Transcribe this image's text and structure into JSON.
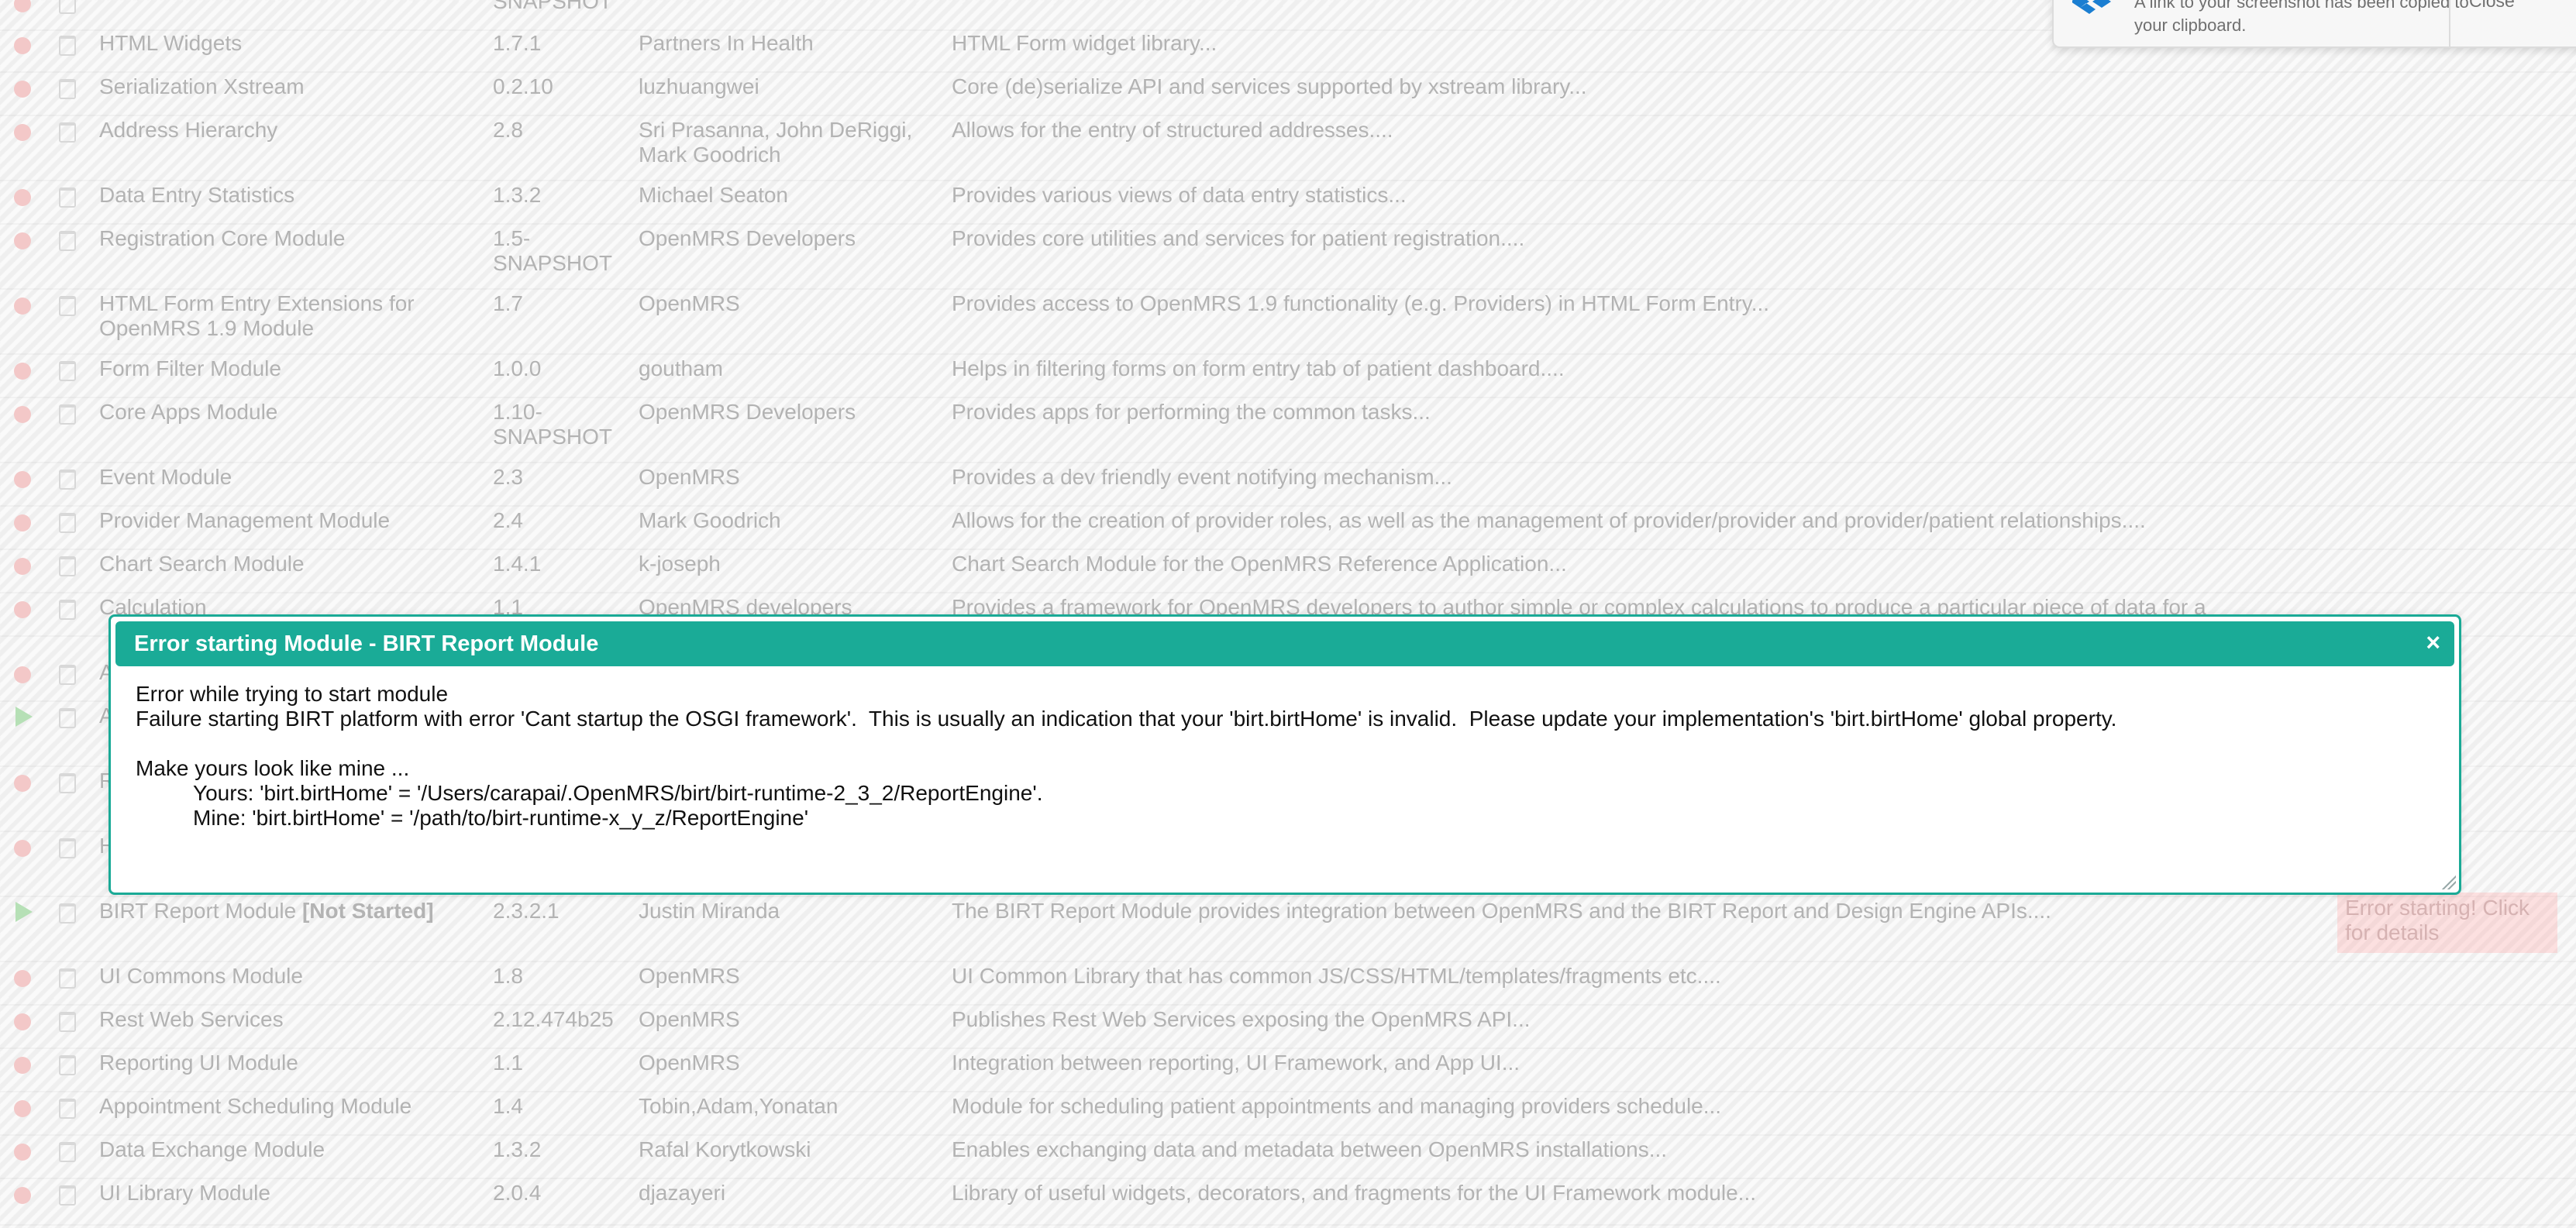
{
  "rows": [
    {
      "name": "",
      "name_suffix": "",
      "version": "SNAPSHOT",
      "author": "",
      "description": "",
      "status": "",
      "icon": "stop-icon"
    },
    {
      "name": "HTML Widgets",
      "name_suffix": "",
      "version": "1.7.1",
      "author": "Partners In Health",
      "description": "HTML Form widget library...",
      "status": "",
      "icon": "stop-icon"
    },
    {
      "name": "Serialization Xstream",
      "name_suffix": "",
      "version": "0.2.10",
      "author": "luzhuangwei",
      "description": "Core (de)serialize API and services supported by xstream library...",
      "status": "",
      "icon": "stop-icon"
    },
    {
      "name": "Address Hierarchy",
      "name_suffix": "",
      "version": "2.8",
      "author": "Sri Prasanna, John DeRiggi, Mark Goodrich",
      "description": "Allows for the entry of structured addresses....",
      "status": "",
      "icon": "stop-icon"
    },
    {
      "name": "Data Entry Statistics",
      "name_suffix": "",
      "version": "1.3.2",
      "author": "Michael Seaton",
      "description": "Provides various views of data entry statistics...",
      "status": "",
      "icon": "stop-icon"
    },
    {
      "name": "Registration Core Module",
      "name_suffix": "",
      "version": "1.5-SNAPSHOT",
      "author": "OpenMRS Developers",
      "description": "Provides core utilities and services for patient registration....",
      "status": "",
      "icon": "stop-icon"
    },
    {
      "name": "HTML Form Entry Extensions for OpenMRS 1.9 Module",
      "name_suffix": "",
      "version": "1.7",
      "author": "OpenMRS",
      "description": "Provides access to OpenMRS 1.9 functionality (e.g. Providers) in HTML Form Entry...",
      "status": "",
      "icon": "stop-icon"
    },
    {
      "name": "Form Filter Module",
      "name_suffix": "",
      "version": "1.0.0",
      "author": "goutham",
      "description": "Helps in filtering forms on form entry tab of patient dashboard....",
      "status": "",
      "icon": "stop-icon"
    },
    {
      "name": "Core Apps Module",
      "name_suffix": "",
      "version": "1.10-SNAPSHOT",
      "author": "OpenMRS Developers",
      "description": "Provides apps for performing the common tasks...",
      "status": "",
      "icon": "stop-icon"
    },
    {
      "name": "Event Module",
      "name_suffix": "",
      "version": "2.3",
      "author": "OpenMRS",
      "description": "Provides a dev friendly event notifying mechanism...",
      "status": "",
      "icon": "stop-icon"
    },
    {
      "name": "Provider Management Module",
      "name_suffix": "",
      "version": "2.4",
      "author": "Mark Goodrich",
      "description": "Allows for the creation of provider roles, as well as the management of provider/provider and provider/patient relationships....",
      "status": "",
      "icon": "stop-icon"
    },
    {
      "name": "Chart Search Module",
      "name_suffix": "",
      "version": "1.4.1",
      "author": "k-joseph",
      "description": "Chart Search Module for the OpenMRS Reference Application...",
      "status": "",
      "icon": "stop-icon"
    },
    {
      "name": "Calculation",
      "name_suffix": "",
      "version": "1.1",
      "author": "OpenMRS developers",
      "description": "Provides a framework for OpenMRS developers to author simple or complex calculations to produce a particular piece of data for a",
      "status": "",
      "icon": "stop-icon"
    },
    {
      "name": "A",
      "name_suffix": "",
      "version": "",
      "author": "",
      "description": "",
      "status": "",
      "icon": "stop-icon"
    },
    {
      "name": "A",
      "name_suffix": "",
      "version": "",
      "author": "",
      "description": "",
      "status": "",
      "icon": "play-icon"
    },
    {
      "name": "R",
      "name_suffix": "",
      "version": "",
      "author": "",
      "description": "",
      "status": "",
      "icon": "stop-icon"
    },
    {
      "name": "H",
      "name_suffix": "",
      "version": "",
      "author": "",
      "description": "",
      "status": "",
      "icon": "stop-icon"
    },
    {
      "name": "BIRT Report Module ",
      "name_suffix": "[Not Started]",
      "version": "2.3.2.1",
      "author": "Justin Miranda",
      "description": "The BIRT Report Module provides integration between OpenMRS and the BIRT Report and Design Engine APIs....",
      "status": "Error starting! Click for details",
      "icon": "play-icon"
    },
    {
      "name": "UI Commons Module",
      "name_suffix": "",
      "version": "1.8",
      "author": "OpenMRS",
      "description": "UI Common Library that has common JS/CSS/HTML/templates/fragments etc....",
      "status": "",
      "icon": "stop-icon"
    },
    {
      "name": "Rest Web Services",
      "name_suffix": "",
      "version": "2.12.474b25",
      "author": "OpenMRS",
      "description": "Publishes Rest Web Services exposing the OpenMRS API...",
      "status": "",
      "icon": "stop-icon"
    },
    {
      "name": "Reporting UI Module",
      "name_suffix": "",
      "version": "1.1",
      "author": "OpenMRS",
      "description": "Integration between reporting, UI Framework, and App UI...",
      "status": "",
      "icon": "stop-icon"
    },
    {
      "name": "Appointment Scheduling Module",
      "name_suffix": "",
      "version": "1.4",
      "author": "Tobin,Adam,Yonatan",
      "description": "Module for scheduling patient appointments and managing providers schedule...",
      "status": "",
      "icon": "stop-icon"
    },
    {
      "name": "Data Exchange Module",
      "name_suffix": "",
      "version": "1.3.2",
      "author": "Rafal Korytkowski",
      "description": "Enables exchanging data and metadata between OpenMRS installations...",
      "status": "",
      "icon": "stop-icon"
    },
    {
      "name": "UI Library Module",
      "name_suffix": "",
      "version": "2.0.4",
      "author": "djazayeri",
      "description": "Library of useful widgets, decorators, and fragments for the UI Framework module...",
      "status": "",
      "icon": "stop-icon"
    }
  ],
  "toast": {
    "message": "A link to your screenshot has been copied to your clipboard.",
    "close_label": "Close",
    "icon": "dropbox-icon"
  },
  "dialog": {
    "title": "Error starting Module - BIRT Report Module",
    "close_label": "×",
    "line1": "Error while trying to start module",
    "line2": "Failure starting BIRT platform with error 'Cant startup the OSGI framework'.  This is usually an indication that your 'birt.birtHome' is invalid.  Please update your implementation's 'birt.birtHome' global property.",
    "line3": "Make yours look like mine ...",
    "line4": "Yours: 'birt.birtHome' = '/Users/carapai/.OpenMRS/birt/birt-runtime-2_3_2/ReportEngine'.",
    "line5": "Mine: 'birt.birtHome' = '/path/to/birt-runtime-x_y_z/ReportEngine'"
  },
  "colors": {
    "dialog_accent": "#1aab97",
    "error_badge_bg": "#fbd8d8",
    "stop_icon": "#f3c8c8",
    "play_icon": "#b6e0b6"
  }
}
